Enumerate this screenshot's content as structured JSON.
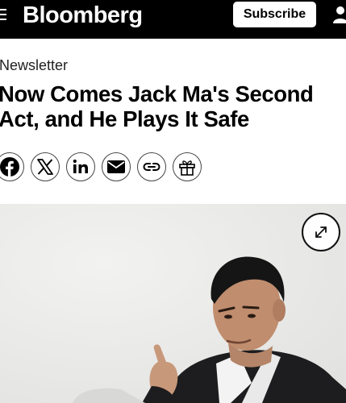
{
  "header": {
    "brand": "Bloomberg",
    "subscribe_label": "Subscribe",
    "menu_icon": "hamburger-menu-icon",
    "user_icon": "user-icon"
  },
  "article": {
    "kicker": "Newsletter",
    "headline": "Now Comes Jack Ma's Second Act, and He Plays It Safe",
    "share_icons": [
      "facebook-icon",
      "x-icon",
      "linkedin-icon",
      "email-icon",
      "copy-link-icon",
      "gift-icon"
    ],
    "hero_image": {
      "expand_icon": "expand-icon"
    }
  },
  "colors": {
    "topbar": "#000000",
    "background": "#ffffff",
    "hero_bg": "#ececea",
    "text": "#000000"
  }
}
